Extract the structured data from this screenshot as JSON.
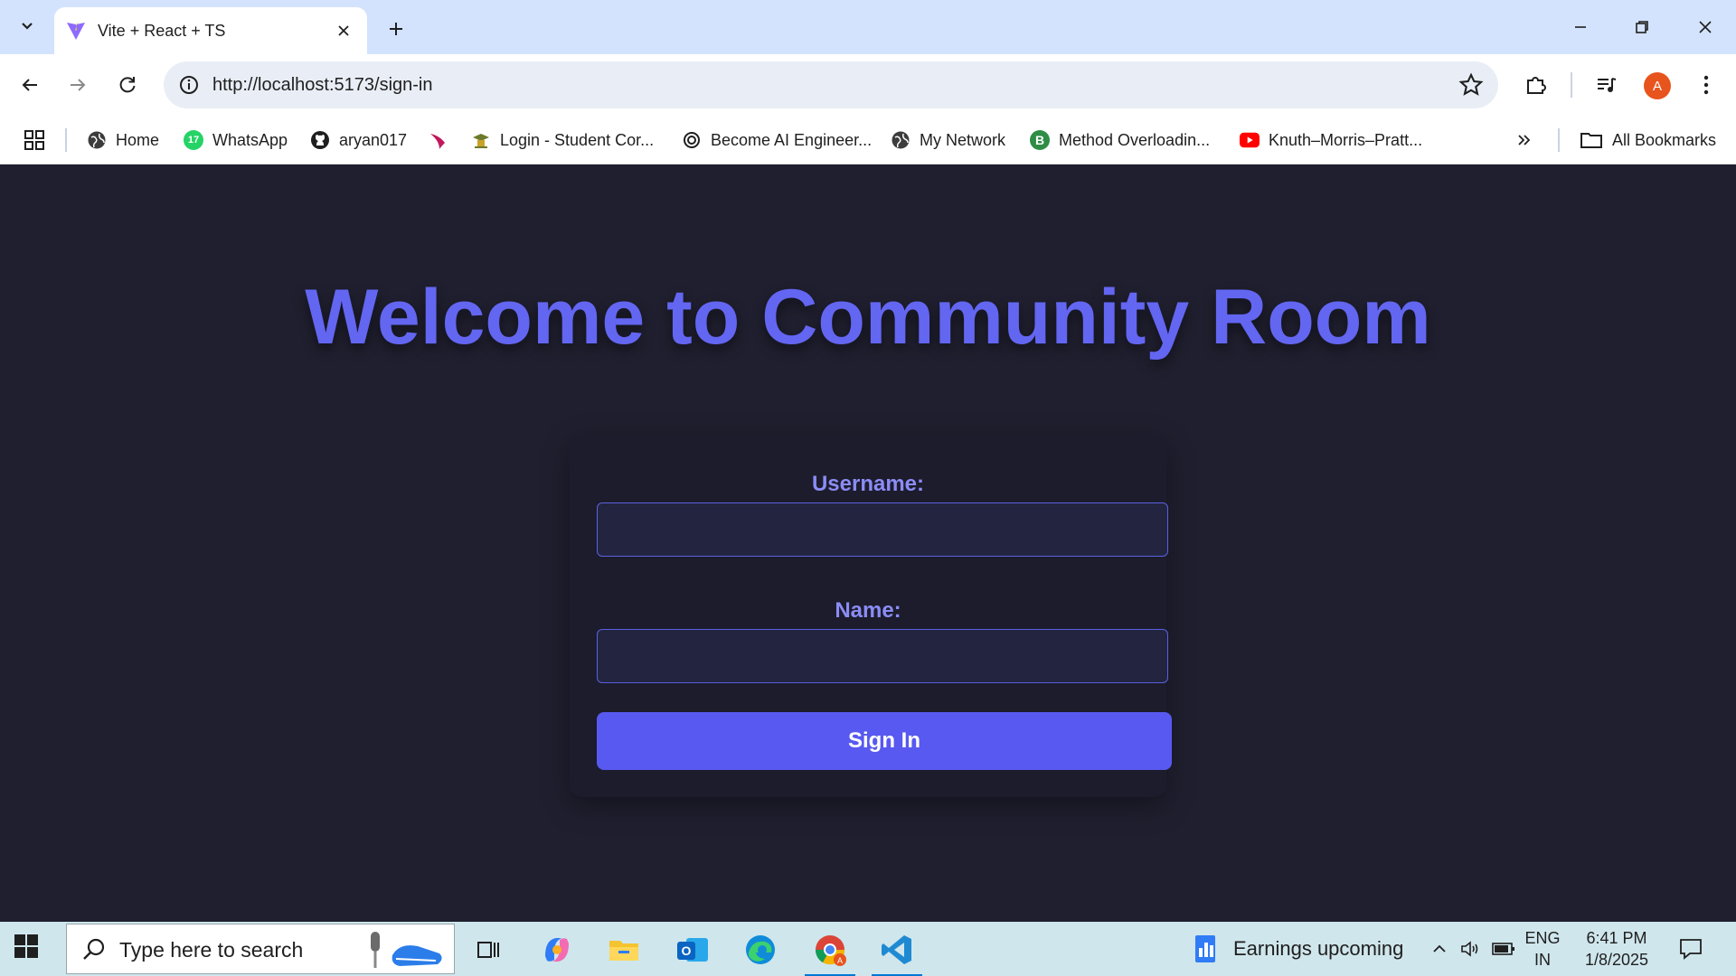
{
  "browser": {
    "tab_title": "Vite + React + TS",
    "url": "http://localhost:5173/sign-in",
    "profile_initial": "A"
  },
  "bookmarks": [
    {
      "label": "Home",
      "icon": "globe-icon"
    },
    {
      "label": "WhatsApp",
      "icon": "whatsapp-icon",
      "badge": "17"
    },
    {
      "label": "aryan017",
      "icon": "github-icon"
    },
    {
      "label": "",
      "icon": "swoosh-icon"
    },
    {
      "label": "Login - Student Cor...",
      "icon": "student-icon"
    },
    {
      "label": "Become AI Engineer...",
      "icon": "openai-icon"
    },
    {
      "label": "My Network",
      "icon": "globe-icon"
    },
    {
      "label": "Method Overloadin...",
      "icon": "b-icon"
    },
    {
      "label": "Knuth–Morris–Pratt...",
      "icon": "youtube-icon"
    }
  ],
  "all_bookmarks": "All Bookmarks",
  "page": {
    "heading": "Welcome to Community Room",
    "username_label": "Username:",
    "username_value": "",
    "name_label": "Name:",
    "name_value": "",
    "submit_label": "Sign In"
  },
  "taskbar": {
    "search_placeholder": "Type here to search",
    "news": "Earnings upcoming",
    "lang_line1": "ENG",
    "lang_line2": "IN",
    "time": "6:41 PM",
    "date": "1/8/2025"
  },
  "colors": {
    "accent": "#6366f1",
    "background": "#1f1f2f",
    "button": "#5859f0"
  }
}
